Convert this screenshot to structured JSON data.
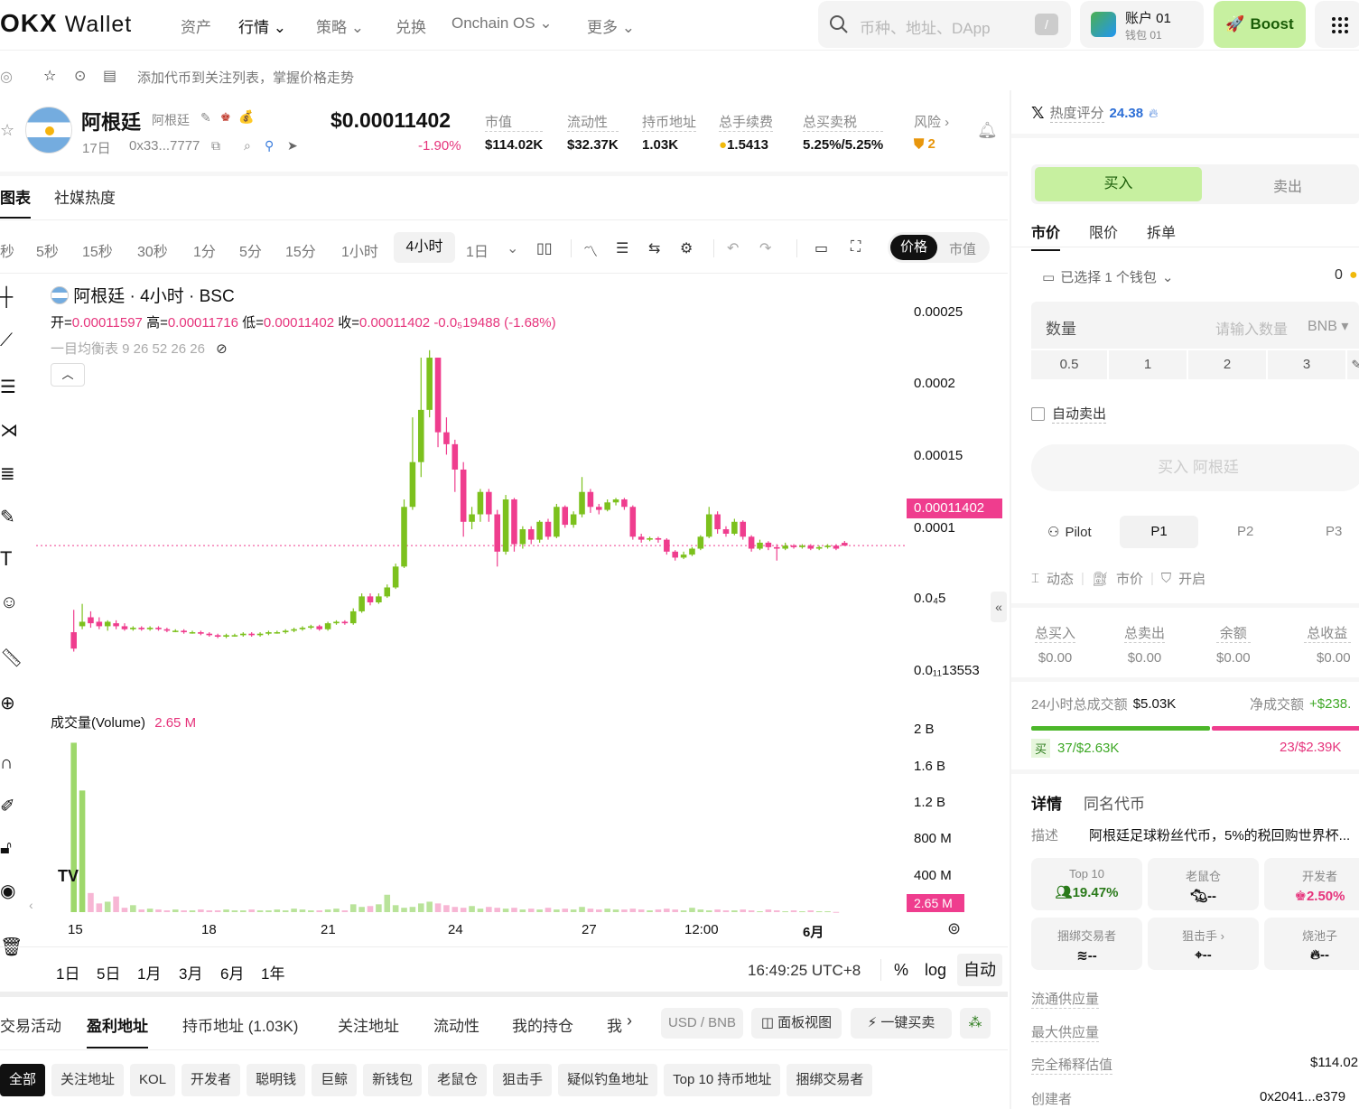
{
  "nav": {
    "logo_text": "OKX",
    "wallet": "Wallet",
    "items": [
      "资产",
      "行情",
      "策略",
      "兑换",
      "Onchain OS",
      "更多"
    ],
    "search_placeholder": "币种、地址、DApp",
    "search_key": "/",
    "account_name": "账户 01",
    "wallet_name": "钱包 01",
    "boost": "Boost"
  },
  "subbar": {
    "hint": "添加代币到关注列表，掌握价格走势"
  },
  "token": {
    "name": "阿根廷",
    "symbol": "阿根廷",
    "age": "17日",
    "address": "0x33...7777",
    "price": "$0.00011402",
    "change": "-1.90%",
    "stats": [
      {
        "label": "市值",
        "value": "$114.02K"
      },
      {
        "label": "流动性",
        "value": "$32.37K"
      },
      {
        "label": "持币地址",
        "value": "1.03K"
      },
      {
        "label": "总手续费",
        "value": "1.5413"
      },
      {
        "label": "总买卖税",
        "value": "5.25%/5.25%"
      },
      {
        "label": "风险 ›",
        "value": "2"
      }
    ]
  },
  "chart_tabs": [
    "图表",
    "社媒热度"
  ],
  "timeframes": [
    "秒",
    "5秒",
    "15秒",
    "30秒",
    "1分",
    "5分",
    "15分",
    "1小时",
    "4小时",
    "1日"
  ],
  "active_tf": "4小时",
  "toggle": {
    "price": "价格",
    "mcap": "市值"
  },
  "legend": {
    "title": "阿根廷 · 4小时 · BSC",
    "open_l": "开=",
    "open": "0.00011597",
    "high_l": "高=",
    "high": "0.00011716",
    "low_l": "低=",
    "low": "0.00011402",
    "close_l": "收=",
    "close": "0.00011402",
    "chg": "-0.0₅19488 (-1.68%)",
    "ichimoku": "一目均衡表 9 26 52 26 26",
    "volume_label": "成交量(Volume)",
    "volume_value": "2.65 M"
  },
  "price_axis": [
    "0.00025",
    "0.0002",
    "0.00015",
    "0.0001",
    "0.0₄5",
    "0.0₁₁13553"
  ],
  "price_tag": "0.00011402",
  "vol_axis": [
    "2 B",
    "1.6 B",
    "1.2 B",
    "800 M",
    "400 M"
  ],
  "vol_tag": "2.65 M",
  "time_axis": [
    "15",
    "18",
    "21",
    "24",
    "27",
    "12:00",
    "6月"
  ],
  "range_buttons": [
    "1日",
    "5日",
    "1月",
    "3月",
    "6月",
    "1年"
  ],
  "clock": "16:49:25 UTC+8",
  "axis_opts": {
    "pct": "%",
    "log": "log",
    "auto": "自动"
  },
  "bottom_tabs": [
    "交易活动",
    "盈利地址",
    "持币地址 (1.03K)",
    "关注地址",
    "流动性",
    "我的持仓",
    "我"
  ],
  "bottom_active": "盈利地址",
  "bottom_right": {
    "currency": "USD / BNB",
    "panel": "面板视图",
    "oneclick": "一键买卖"
  },
  "filters": [
    "全部",
    "关注地址",
    "KOL",
    "开发者",
    "聪明钱",
    "巨鲸",
    "新钱包",
    "老鼠仓",
    "狙击手",
    "疑似钓鱼地址",
    "Top 10 持币地址",
    "捆绑交易者"
  ],
  "rp": {
    "heat_label": "热度评分",
    "heat_value": "24.38",
    "buy": "买入",
    "sell": "卖出",
    "order_tabs": [
      "市价",
      "限价",
      "拆单"
    ],
    "wallet_sel": "已选择 1 个钱包",
    "wallet_bal": "0",
    "qty_label": "数量",
    "qty_ph": "请输入数量",
    "qty_unit": "BNB",
    "presets": [
      "0.5",
      "1",
      "2",
      "3"
    ],
    "auto_sell": "自动卖出",
    "buy_btn": "买入 阿根廷",
    "pilot": "Pilot",
    "presets2": [
      "P1",
      "P2",
      "P3"
    ],
    "opt1": "动态",
    "opt2": "市价",
    "opt3": "开启",
    "totals": [
      {
        "label": "总买入",
        "value": "$0.00"
      },
      {
        "label": "总卖出",
        "value": "$0.00"
      },
      {
        "label": "余额",
        "value": "$0.00"
      },
      {
        "label": "总收益",
        "value": "$0.00"
      }
    ],
    "vol24_label": "24小时总成交额",
    "vol24": "$5.03K",
    "net_label": "净成交额",
    "net": "+$238.",
    "buy_lbl": "买",
    "buy_stat": "37/$2.63K",
    "sell_stat": "23/$2.39K",
    "details_tab": "详情",
    "same_tab": "同名代币",
    "desc_label": "描述",
    "desc": "阿根廷足球粉丝代币，5%的税回购世界杯...",
    "holders": [
      {
        "label": "Top 10",
        "value": "19.47%"
      },
      {
        "label": "老鼠仓",
        "value": "--"
      },
      {
        "label": "开发者",
        "value": "2.50%"
      },
      {
        "label": "捆绑交易者",
        "value": "--"
      },
      {
        "label": "狙击手 ›",
        "value": "--"
      },
      {
        "label": "烧池子",
        "value": "--"
      }
    ],
    "info": [
      {
        "label": "流通供应量",
        "value": ""
      },
      {
        "label": "最大供应量",
        "value": ""
      },
      {
        "label": "完全稀释估值",
        "value": "$114.02"
      },
      {
        "label": "创建者",
        "value": "0x2041...e379"
      }
    ]
  },
  "colors": {
    "up": "#7cc11d",
    "down": "#ef3d8e",
    "accent": "#c7f0a0"
  },
  "chart_data": {
    "type": "candlestick",
    "x_ticks": [
      "15",
      "18",
      "21",
      "24",
      "27",
      "12:00",
      "6月"
    ],
    "ylim": [
      3e-05,
      0.00026
    ],
    "candles": [
      [
        5.6e-05,
        4.5e-05,
        7.1e-05,
        4.3e-05
      ],
      [
        6e-05,
        6.3e-05,
        7.5e-05,
        5.8e-05
      ],
      [
        6.6e-05,
        6.2e-05,
        7e-05,
        5.9e-05
      ],
      [
        6.3e-05,
        6e-05,
        6.6e-05,
        5.8e-05
      ],
      [
        6e-05,
        6.3e-05,
        6.4e-05,
        5.7e-05
      ],
      [
        6.2e-05,
        6e-05,
        6.4e-05,
        5.8e-05
      ],
      [
        6e-05,
        5.8e-05,
        6.2e-05,
        5.7e-05
      ],
      [
        5.8e-05,
        5.9e-05,
        6e-05,
        5.7e-05
      ],
      [
        5.9e-05,
        5.8e-05,
        6e-05,
        5.7e-05
      ],
      [
        5.8e-05,
        5.9e-05,
        6e-05,
        5.7e-05
      ],
      [
        5.9e-05,
        5.8e-05,
        6e-05,
        5.7e-05
      ],
      [
        5.8e-05,
        5.7e-05,
        5.9e-05,
        5.6e-05
      ],
      [
        5.7e-05,
        5.7e-05,
        5.8e-05,
        5.6e-05
      ],
      [
        5.7e-05,
        5.6e-05,
        5.8e-05,
        5.5e-05
      ],
      [
        5.6e-05,
        5.6e-05,
        5.7e-05,
        5.5e-05
      ],
      [
        5.6e-05,
        5.5e-05,
        5.7e-05,
        5.4e-05
      ],
      [
        5.5e-05,
        5.4e-05,
        5.6e-05,
        5.3e-05
      ],
      [
        5.4e-05,
        5.3e-05,
        5.5e-05,
        5.2e-05
      ],
      [
        5.3e-05,
        5.4e-05,
        5.5e-05,
        5.2e-05
      ],
      [
        5.4e-05,
        5.4e-05,
        5.5e-05,
        5.3e-05
      ],
      [
        5.4e-05,
        5.5e-05,
        5.6e-05,
        5.3e-05
      ],
      [
        5.5e-05,
        5.4e-05,
        5.6e-05,
        5.3e-05
      ],
      [
        5.4e-05,
        5.5e-05,
        5.6e-05,
        5.3e-05
      ],
      [
        5.5e-05,
        5.6e-05,
        5.7e-05,
        5.4e-05
      ],
      [
        5.6e-05,
        5.6e-05,
        5.7e-05,
        5.5e-05
      ],
      [
        5.6e-05,
        5.7e-05,
        5.8e-05,
        5.5e-05
      ],
      [
        5.7e-05,
        5.8e-05,
        5.9e-05,
        5.6e-05
      ],
      [
        5.8e-05,
        5.9e-05,
        6e-05,
        5.7e-05
      ],
      [
        5.9e-05,
        6e-05,
        6.1e-05,
        5.8e-05
      ],
      [
        6e-05,
        5.8e-05,
        6.1e-05,
        5.7e-05
      ],
      [
        5.8e-05,
        6.2e-05,
        6.3e-05,
        5.7e-05
      ],
      [
        6.2e-05,
        6.3e-05,
        6.4e-05,
        6.1e-05
      ],
      [
        6.3e-05,
        6.2e-05,
        6.4e-05,
        6.1e-05
      ],
      [
        6.2e-05,
        7e-05,
        7.2e-05,
        6.1e-05
      ],
      [
        7e-05,
        8e-05,
        8.2e-05,
        6.9e-05
      ],
      [
        8e-05,
        7.6e-05,
        8.2e-05,
        7.4e-05
      ],
      [
        7.6e-05,
        8e-05,
        8.2e-05,
        7.5e-05
      ],
      [
        8e-05,
        8.6e-05,
        8.8e-05,
        7.9e-05
      ],
      [
        8.6e-05,
        0.0001,
        0.000102,
        8.5e-05
      ],
      [
        0.0001,
        0.00014,
        0.000145,
        9.9e-05
      ],
      [
        0.00014,
        0.00017,
        0.0002,
        0.000138
      ],
      [
        0.00017,
        0.000205,
        0.00024,
        0.00016
      ],
      [
        0.000205,
        0.00024,
        0.000245,
        0.0002
      ],
      [
        0.00024,
        0.00019,
        0.00024,
        0.00018
      ],
      [
        0.00019,
        0.000182,
        0.0002,
        0.000175
      ],
      [
        0.000182,
        0.000165,
        0.000185,
        0.00015
      ],
      [
        0.000165,
        0.00013,
        0.00017,
        0.00012
      ],
      [
        0.00013,
        0.000135,
        0.00014,
        0.000125
      ],
      [
        0.000135,
        0.00015,
        0.000152,
        0.00013
      ],
      [
        0.00015,
        0.000135,
        0.000152,
        0.00013
      ],
      [
        0.000135,
        0.00011,
        0.000138,
        0.0001
      ],
      [
        0.00011,
        0.000145,
        0.000148,
        0.000108
      ],
      [
        0.000145,
        0.000115,
        0.000146,
        0.00011
      ],
      [
        0.000115,
        0.000125,
        0.000127,
        0.000112
      ],
      [
        0.000125,
        0.000118,
        0.000127,
        0.000115
      ],
      [
        0.000118,
        0.00013,
        0.000131,
        0.000116
      ],
      [
        0.00013,
        0.00012,
        0.000132,
        0.000118
      ],
      [
        0.00012,
        0.00014,
        0.000142,
        0.000119
      ],
      [
        0.00014,
        0.000128,
        0.000141,
        0.000126
      ],
      [
        0.000128,
        0.000135,
        0.000137,
        0.000126
      ],
      [
        0.000135,
        0.00015,
        0.00016,
        0.000133
      ],
      [
        0.00015,
        0.00014,
        0.000152,
        0.000136
      ],
      [
        0.00014,
        0.000138,
        0.000142,
        0.000135
      ],
      [
        0.000138,
        0.000143,
        0.000145,
        0.000137
      ],
      [
        0.000143,
        0.000145,
        0.000146,
        0.000141
      ],
      [
        0.000145,
        0.00014,
        0.000146,
        0.000138
      ],
      [
        0.00014,
        0.00012,
        0.000141,
        0.000118
      ],
      [
        0.00012,
        0.000118,
        0.000122,
        0.000116
      ],
      [
        0.000118,
        0.000119,
        0.00012,
        0.000117
      ],
      [
        0.000119,
        0.000118,
        0.00012,
        0.000116
      ],
      [
        0.000118,
        0.00011,
        0.000119,
        0.000108
      ],
      [
        0.00011,
        0.000106,
        0.000111,
        0.000104
      ],
      [
        0.000106,
        0.000108,
        0.00011,
        0.000105
      ],
      [
        0.000108,
        0.000112,
        0.000113,
        0.000107
      ],
      [
        0.000112,
        0.00012,
        0.000121,
        0.000111
      ],
      [
        0.00012,
        0.000135,
        0.00014,
        0.000119
      ],
      [
        0.000135,
        0.000125,
        0.000137,
        0.000122
      ],
      [
        0.000125,
        0.000122,
        0.000127,
        0.00012
      ],
      [
        0.000122,
        0.00013,
        0.000132,
        0.000121
      ],
      [
        0.00013,
        0.00012,
        0.000131,
        0.000118
      ],
      [
        0.00012,
        0.000112,
        0.000121,
        0.00011
      ],
      [
        0.000112,
        0.000116,
        0.000118,
        0.000111
      ],
      [
        0.000116,
        0.000113,
        0.000117,
        0.000111
      ],
      [
        0.000113,
        0.000112,
        0.000115,
        0.000104
      ],
      [
        0.000112,
        0.000114,
        0.000116,
        0.000111
      ],
      [
        0.000114,
        0.000113,
        0.000115,
        0.000112
      ],
      [
        0.000113,
        0.000114,
        0.000115,
        0.000112
      ],
      [
        0.000114,
        0.000112,
        0.000115,
        0.000111
      ],
      [
        0.000112,
        0.000113,
        0.000114,
        0.000111
      ],
      [
        0.000113,
        0.000114,
        0.000115,
        0.000112
      ],
      [
        0.000114,
        0.000112,
        0.000115,
        0.000111
      ],
      [
        0.0001159,
        0.00011402,
        0.00011716,
        0.00011402
      ]
    ],
    "volumes": [
      1.95,
      1.4,
      0.22,
      0.1,
      0.12,
      0.18,
      0.05,
      0.08,
      0.03,
      0.04,
      0.03,
      0.02,
      0.03,
      0.02,
      0.02,
      0.03,
      0.02,
      0.02,
      0.03,
      0.02,
      0.02,
      0.03,
      0.02,
      0.02,
      0.03,
      0.02,
      0.04,
      0.03,
      0.02,
      0.02,
      0.03,
      0.04,
      0.02,
      0.09,
      0.06,
      0.07,
      0.09,
      0.2,
      0.08,
      0.05,
      0.06,
      0.1,
      0.12,
      0.1,
      0.08,
      0.06,
      0.05,
      0.07,
      0.04,
      0.06,
      0.05,
      0.04,
      0.05,
      0.03,
      0.04,
      0.03,
      0.05,
      0.03,
      0.04,
      0.03,
      0.06,
      0.04,
      0.03,
      0.04,
      0.03,
      0.03,
      0.04,
      0.03,
      0.02,
      0.03,
      0.04,
      0.03,
      0.02,
      0.05,
      0.03,
      0.02,
      0.03,
      0.02,
      0.02,
      0.03,
      0.02,
      0.01,
      0.03,
      0.02,
      0.01,
      0.02,
      0.01,
      0.02,
      0.01,
      0.01,
      0.0027
    ],
    "volume_ylim": [
      0,
      2.1
    ]
  }
}
